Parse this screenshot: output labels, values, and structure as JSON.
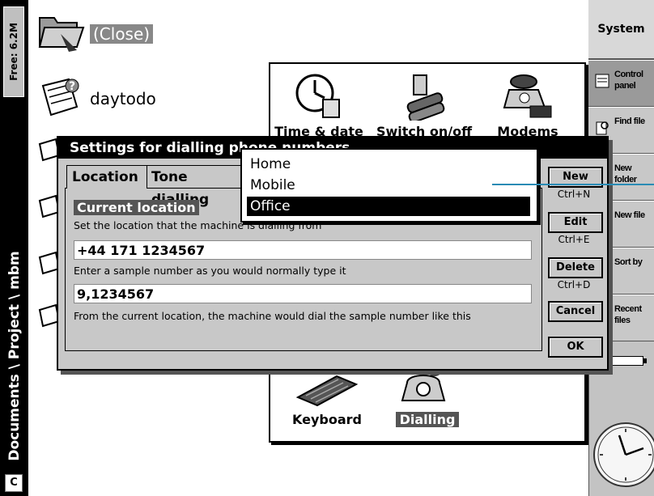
{
  "status": {
    "free_memory": "Free: 6.2M",
    "path": "Documents \\ Project \\ mbm",
    "caps_indicator": "C"
  },
  "files": {
    "close_label": "(Close)",
    "daytodo_label": "daytodo"
  },
  "sidebar": {
    "system_label": "System",
    "items": [
      {
        "label": "Control panel"
      },
      {
        "label": "Find file"
      },
      {
        "label": "New folder"
      },
      {
        "label": "New file"
      },
      {
        "label": "Sort by"
      },
      {
        "label": "Recent files"
      }
    ]
  },
  "control_panel": {
    "items": [
      {
        "label": "Time & date"
      },
      {
        "label": "Switch on/off"
      },
      {
        "label": "Modems"
      },
      {
        "label": "Keyboard"
      },
      {
        "label": "Dialling"
      }
    ]
  },
  "dialog": {
    "title": "Settings for dialling phone numbers",
    "tabs": [
      "Location",
      "Tone dialling"
    ],
    "section_heading": "Current location",
    "location_hint": "Set the location that the machine is dialling from",
    "location_number": "+44 171 1234567",
    "sample_hint": "Enter a sample number as you would normally type it",
    "sample_number": "9,1234567",
    "result_hint": "From the current location, the machine would dial the sample number like this",
    "buttons": {
      "new": "New",
      "new_shortcut": "Ctrl+N",
      "edit": "Edit",
      "edit_shortcut": "Ctrl+E",
      "delete": "Delete",
      "delete_shortcut": "Ctrl+D",
      "cancel": "Cancel",
      "ok": "OK"
    }
  },
  "dropdown": {
    "options": [
      "Home",
      "Mobile",
      "Office"
    ],
    "selected": "Office"
  },
  "colors": {
    "sidebar": "#c3c3c3",
    "selection": "#000000",
    "pointer_line": "#2a8bb5"
  }
}
